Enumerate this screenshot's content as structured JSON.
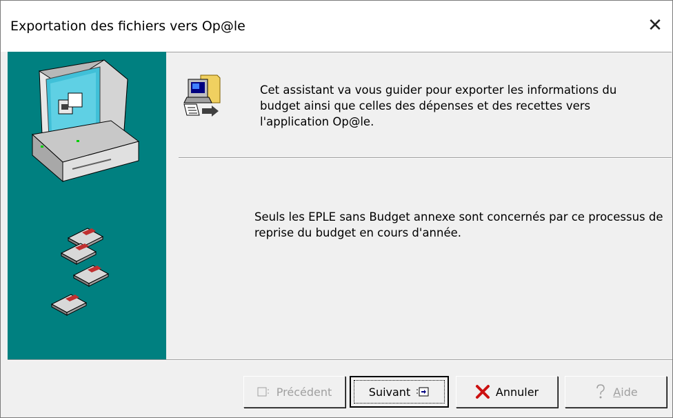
{
  "window": {
    "title": "Exportation des fichiers vers Op@le",
    "close_glyph": "✕"
  },
  "content": {
    "intro_text": "Cet assistant va vous guider pour exporter les informations du budget ainsi que celles des dépenses et des recettes vers l'application Op@le.",
    "note_text": "Seuls les EPLE sans Budget annexe sont concernés par ce processus de reprise du budget en cours d'année."
  },
  "buttons": {
    "previous": {
      "label": "Précédent",
      "enabled": false,
      "icon": "previous-page-icon"
    },
    "next": {
      "label": "Suivant",
      "enabled": true,
      "icon": "next-page-icon"
    },
    "cancel": {
      "label": "Annuler",
      "enabled": true,
      "icon": "red-x-icon"
    },
    "help": {
      "label_accel": "A",
      "label_rest": "ide",
      "enabled": false,
      "icon": "help-question-icon"
    }
  },
  "colors": {
    "side_panel": "#008080",
    "cancel_icon": "#cc1010",
    "disabled_text": "#a0a0a0"
  }
}
